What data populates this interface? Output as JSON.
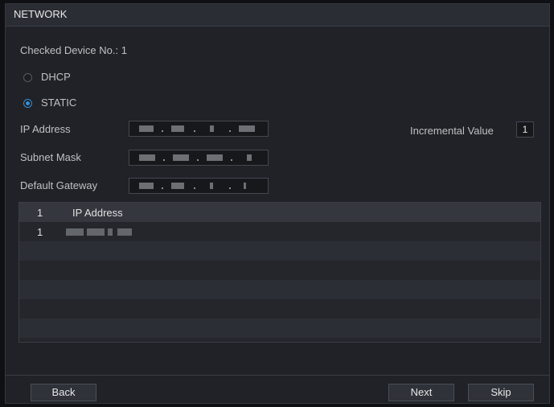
{
  "window": {
    "title": "NETWORK"
  },
  "form": {
    "checked_device_label": "Checked Device No.: 1",
    "dhcp_label": "DHCP",
    "static_label": "STATIC",
    "selected_mode": "STATIC",
    "ip_address_label": "IP Address",
    "subnet_mask_label": "Subnet Mask",
    "default_gateway_label": "Default Gateway",
    "incremental_value_label": "Incremental Value",
    "incremental_value": "1"
  },
  "table": {
    "columns": [
      "1",
      "IP Address"
    ],
    "rows": [
      {
        "index": "1"
      }
    ]
  },
  "buttons": {
    "back": "Back",
    "next": "Next",
    "skip": "Skip"
  },
  "colors": {
    "accent": "#3a8fd8",
    "background": "#202227",
    "header": "#2a2d33"
  }
}
